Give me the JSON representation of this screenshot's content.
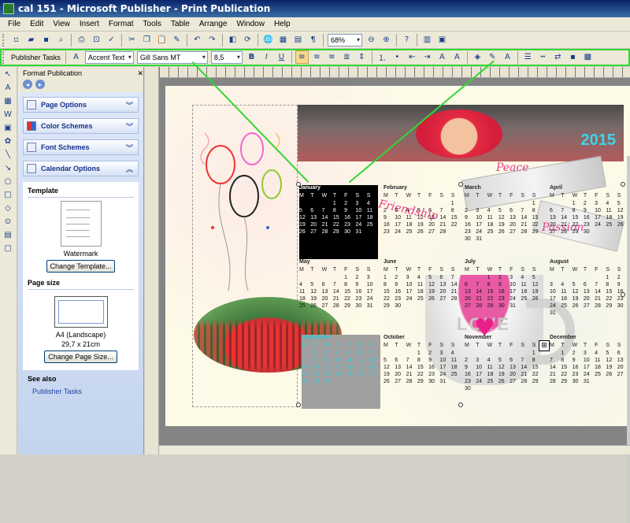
{
  "window": {
    "title": "cal 151 - Microsoft Publisher - Print Publication"
  },
  "menu": [
    "File",
    "Edit",
    "View",
    "Insert",
    "Format",
    "Tools",
    "Table",
    "Arrange",
    "Window",
    "Help"
  ],
  "standard_toolbar": {
    "zoom": "68%"
  },
  "formatting_toolbar": {
    "publisher_tasks": "Publisher Tasks",
    "style": "Accent Text",
    "font": "Gill Sans MT",
    "size": "8,5",
    "bold": "B",
    "italic": "I",
    "underline": "U"
  },
  "task_pane": {
    "title": "Format Publication",
    "sections": [
      {
        "label": "Page Options",
        "icon": "page-options-icon"
      },
      {
        "label": "Color Schemes",
        "icon": "color-schemes-icon"
      },
      {
        "label": "Font Schemes",
        "icon": "font-schemes-icon"
      },
      {
        "label": "Calendar Options",
        "icon": "calendar-options-icon"
      }
    ],
    "template_heading": "Template",
    "template_name": "Watermark",
    "change_template": "Change Template...",
    "page_size_heading": "Page size",
    "page_size_name": "A4 (Landscape)",
    "page_size_dims": "29,7 x 21cm",
    "change_page_size": "Change Page Size...",
    "see_also": "See also",
    "publisher_tasks_link": "Publisher Tasks"
  },
  "canvas": {
    "year": "2015",
    "words": {
      "peace": "Peace",
      "friendship": "Friendship",
      "passion": "Passion",
      "love": "LOVE"
    }
  },
  "calendar": {
    "weekdays": [
      "M",
      "T",
      "W",
      "T",
      "F",
      "S",
      "S"
    ],
    "months": [
      {
        "name": "January",
        "days": [
          "",
          "",
          "",
          "1",
          "2",
          "3",
          "4",
          "5",
          "6",
          "7",
          "8",
          "9",
          "10",
          "11",
          "12",
          "13",
          "14",
          "15",
          "16",
          "17",
          "18",
          "19",
          "20",
          "21",
          "22",
          "23",
          "24",
          "25",
          "26",
          "27",
          "28",
          "29",
          "30",
          "31"
        ]
      },
      {
        "name": "February",
        "days": [
          "",
          "",
          "",
          "",
          "",
          "",
          "1",
          "2",
          "3",
          "4",
          "5",
          "6",
          "7",
          "8",
          "9",
          "10",
          "11",
          "12",
          "13",
          "14",
          "15",
          "16",
          "17",
          "18",
          "19",
          "20",
          "21",
          "22",
          "23",
          "24",
          "25",
          "26",
          "27",
          "28"
        ]
      },
      {
        "name": "March",
        "days": [
          "",
          "",
          "",
          "",
          "",
          "",
          "1",
          "2",
          "3",
          "4",
          "5",
          "6",
          "7",
          "8",
          "9",
          "10",
          "11",
          "12",
          "13",
          "14",
          "15",
          "16",
          "17",
          "18",
          "19",
          "20",
          "21",
          "22",
          "23",
          "24",
          "25",
          "26",
          "27",
          "28",
          "29",
          "30",
          "31"
        ]
      },
      {
        "name": "April",
        "days": [
          "",
          "",
          "1",
          "2",
          "3",
          "4",
          "5",
          "6",
          "7",
          "8",
          "9",
          "10",
          "11",
          "12",
          "13",
          "14",
          "15",
          "16",
          "17",
          "18",
          "19",
          "20",
          "21",
          "22",
          "23",
          "24",
          "25",
          "26",
          "27",
          "28",
          "29",
          "30"
        ]
      },
      {
        "name": "May",
        "days": [
          "",
          "",
          "",
          "",
          "1",
          "2",
          "3",
          "4",
          "5",
          "6",
          "7",
          "8",
          "9",
          "10",
          "11",
          "12",
          "13",
          "14",
          "15",
          "16",
          "17",
          "18",
          "19",
          "20",
          "21",
          "22",
          "23",
          "24",
          "25",
          "26",
          "27",
          "28",
          "29",
          "30",
          "31"
        ]
      },
      {
        "name": "June",
        "days": [
          "1",
          "2",
          "3",
          "4",
          "5",
          "6",
          "7",
          "8",
          "9",
          "10",
          "11",
          "12",
          "13",
          "14",
          "15",
          "16",
          "17",
          "18",
          "19",
          "20",
          "21",
          "22",
          "23",
          "24",
          "25",
          "26",
          "27",
          "28",
          "29",
          "30"
        ]
      },
      {
        "name": "July",
        "days": [
          "",
          "",
          "1",
          "2",
          "3",
          "4",
          "5",
          "6",
          "7",
          "8",
          "9",
          "10",
          "11",
          "12",
          "13",
          "14",
          "15",
          "16",
          "17",
          "18",
          "19",
          "20",
          "21",
          "22",
          "23",
          "24",
          "25",
          "26",
          "27",
          "28",
          "29",
          "30",
          "31"
        ]
      },
      {
        "name": "August",
        "days": [
          "",
          "",
          "",
          "",
          "",
          "1",
          "2",
          "3",
          "4",
          "5",
          "6",
          "7",
          "8",
          "9",
          "10",
          "11",
          "12",
          "13",
          "14",
          "15",
          "16",
          "17",
          "18",
          "19",
          "20",
          "21",
          "22",
          "23",
          "24",
          "25",
          "26",
          "27",
          "28",
          "29",
          "30",
          "31"
        ]
      },
      {
        "name": "September",
        "days": [
          "",
          "1",
          "2",
          "3",
          "4",
          "5",
          "6",
          "7",
          "8",
          "9",
          "10",
          "11",
          "12",
          "13",
          "14",
          "15",
          "16",
          "17",
          "18",
          "19",
          "20",
          "21",
          "22",
          "23",
          "24",
          "25",
          "26",
          "27",
          "28",
          "29",
          "30"
        ]
      },
      {
        "name": "October",
        "days": [
          "",
          "",
          "",
          "1",
          "2",
          "3",
          "4",
          "5",
          "6",
          "7",
          "8",
          "9",
          "10",
          "11",
          "12",
          "13",
          "14",
          "15",
          "16",
          "17",
          "18",
          "19",
          "20",
          "21",
          "22",
          "23",
          "24",
          "25",
          "26",
          "27",
          "28",
          "29",
          "30",
          "31"
        ]
      },
      {
        "name": "November",
        "days": [
          "",
          "",
          "",
          "",
          "",
          "",
          "1",
          "2",
          "3",
          "4",
          "5",
          "6",
          "7",
          "8",
          "9",
          "10",
          "11",
          "12",
          "13",
          "14",
          "15",
          "16",
          "17",
          "18",
          "19",
          "20",
          "21",
          "22",
          "23",
          "24",
          "25",
          "26",
          "27",
          "28",
          "29",
          "30"
        ]
      },
      {
        "name": "December",
        "days": [
          "",
          "1",
          "2",
          "3",
          "4",
          "5",
          "6",
          "7",
          "8",
          "9",
          "10",
          "11",
          "12",
          "13",
          "14",
          "15",
          "16",
          "17",
          "18",
          "19",
          "20",
          "21",
          "22",
          "23",
          "24",
          "25",
          "26",
          "27",
          "28",
          "29",
          "30",
          "31"
        ]
      }
    ]
  },
  "colors": {
    "title_bar": "#0a246a",
    "highlight": "#33d633",
    "accent_pink": "#e9208a",
    "year_cyan": "#3cd6e8"
  }
}
